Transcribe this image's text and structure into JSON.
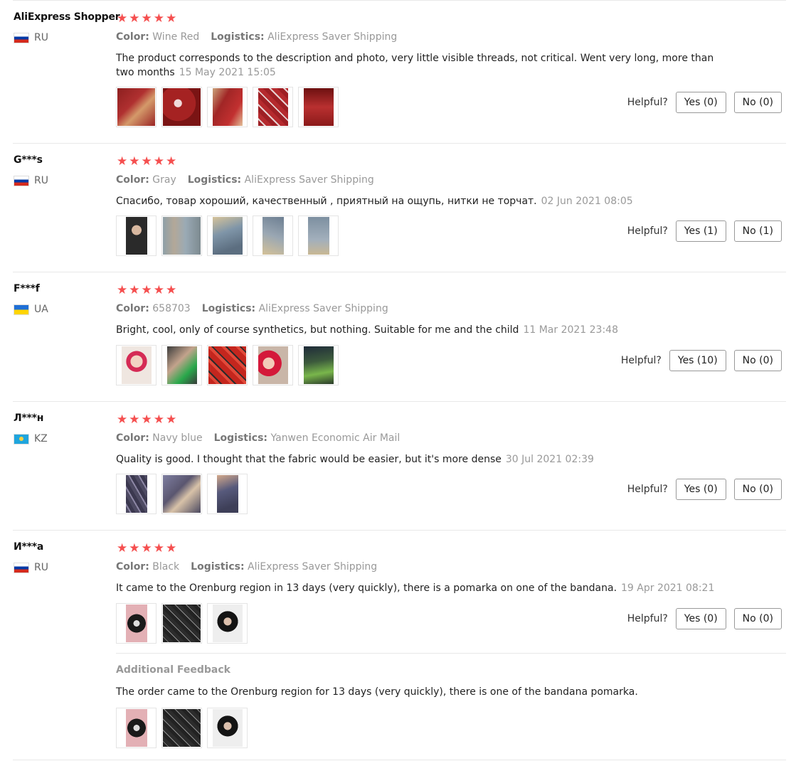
{
  "labels": {
    "color": "Color:",
    "logistics": "Logistics:",
    "helpful": "Helpful?"
  },
  "reviews": [
    {
      "user": "AliExpress Shopper",
      "country": "RU",
      "color": "Wine Red",
      "logistics": "AliExpress Saver Shipping",
      "text": "The product corresponds to the description and photo, very little visible threads, not critical. Went very long, more than two months",
      "date": "15 May 2021 15:05",
      "yes": "Yes (0)",
      "no": "No (0)",
      "images": [
        "bandana-photo-1",
        "bandana-photo-2",
        "bandana-photo-3",
        "bandana-photo-4",
        "bandana-photo-5"
      ]
    },
    {
      "user": "G***s",
      "country": "RU",
      "color": "Gray",
      "logistics": "AliExpress Saver Shipping",
      "text": "Спасибо, товар хороший, качественный , приятный на ощупь, нитки не торчат.",
      "date": "02 Jun 2021 08:05",
      "yes": "Yes (1)",
      "no": "No (1)",
      "images": [
        "bandana-photo-1",
        "bandana-photo-2",
        "bandana-photo-3",
        "bandana-photo-4",
        "bandana-photo-5"
      ]
    },
    {
      "user": "F***f",
      "country": "UA",
      "color": "658703",
      "logistics": "AliExpress Saver Shipping",
      "text": "Bright, cool, only of course synthetics, but nothing. Suitable for me and the child",
      "date": "11 Mar 2021 23:48",
      "yes": "Yes (10)",
      "no": "No (0)",
      "images": [
        "bandana-photo-1",
        "bandana-photo-2",
        "bandana-photo-3",
        "bandana-photo-4",
        "bandana-photo-5"
      ]
    },
    {
      "user": "Л***н",
      "country": "KZ",
      "color": "Navy blue",
      "logistics": "Yanwen Economic Air Mail",
      "text": "Quality is good. I thought that the fabric would be easier, but it's more dense",
      "date": "30 Jul 2021 02:39",
      "yes": "Yes (0)",
      "no": "No (0)",
      "images": [
        "bandana-photo-1",
        "bandana-photo-2",
        "bandana-photo-3"
      ]
    },
    {
      "user": "И***а",
      "country": "RU",
      "color": "Black",
      "logistics": "AliExpress Saver Shipping",
      "text": "It came to the Orenburg region in 13 days (very quickly), there is a pomarka on one of the bandana.",
      "date": "19 Apr 2021 08:21",
      "yes": "Yes (0)",
      "no": "No (0)",
      "images": [
        "bandana-photo-1",
        "bandana-photo-2",
        "bandana-photo-3"
      ],
      "additional": {
        "title": "Additional Feedback",
        "text": "The order came to the Orenburg region for 13 days (very quickly), there is one of the bandana pomarka.",
        "images": [
          "bandana-photo-1",
          "bandana-photo-2",
          "bandana-photo-3"
        ]
      }
    }
  ],
  "rating": {
    "stars": 5
  }
}
